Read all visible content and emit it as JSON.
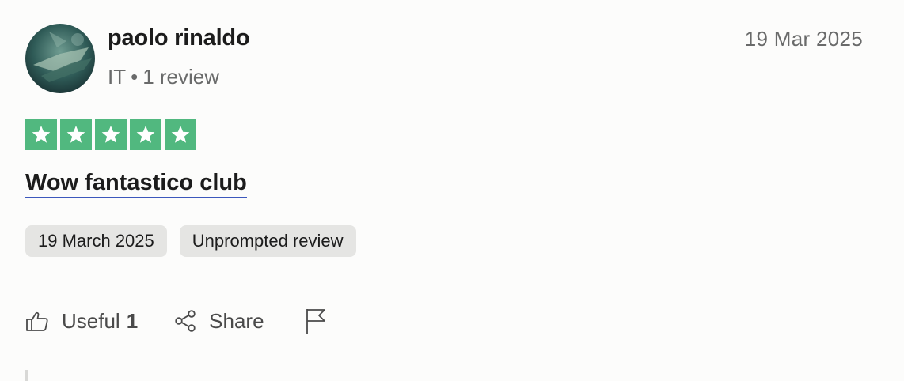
{
  "author": {
    "name": "paolo rinaldo",
    "country": "IT",
    "separator": "•",
    "review_count": "1 review",
    "avatar_icon": "user-photo-avatar"
  },
  "review": {
    "date": "19 Mar 2025",
    "rating": 5,
    "rating_max": 5,
    "title": "Wow fantastico club",
    "badges": [
      "19 March 2025",
      "Unprompted review"
    ]
  },
  "actions": {
    "useful_label": "Useful",
    "useful_count": "1",
    "share_label": "Share",
    "icons": [
      "thumbs-up-icon",
      "share-icon",
      "flag-icon"
    ]
  },
  "colors": {
    "star_green": "#51b87f",
    "title_underline": "#3c57bc",
    "badge_bg": "#e5e5e3",
    "muted_text": "#696a6a"
  }
}
